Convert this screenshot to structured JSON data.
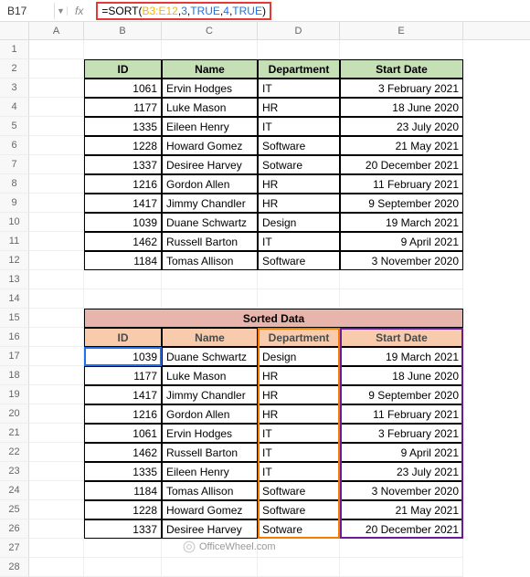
{
  "cellRef": "B17",
  "formula": {
    "eq": "=",
    "fn": "SORT",
    "open": "(",
    "range": "B3:E12",
    "c1": ",",
    "a1": "3",
    "c2": ",",
    "a2": "TRUE",
    "c3": ",",
    "a3": "4",
    "c4": ",",
    "a4": "TRUE",
    "close": ")"
  },
  "cols": [
    "A",
    "B",
    "C",
    "D",
    "E"
  ],
  "table1": {
    "headers": {
      "id": "ID",
      "name": "Name",
      "dept": "Department",
      "date": "Start Date"
    },
    "rows": [
      {
        "id": "1061",
        "name": "Ervin Hodges",
        "dept": "IT",
        "date": "3 February 2021"
      },
      {
        "id": "1177",
        "name": "Luke Mason",
        "dept": "HR",
        "date": "18 June 2020"
      },
      {
        "id": "1335",
        "name": "Eileen Henry",
        "dept": "IT",
        "date": "23 July 2020"
      },
      {
        "id": "1228",
        "name": "Howard Gomez",
        "dept": "Software",
        "date": "21 May 2021"
      },
      {
        "id": "1337",
        "name": "Desiree Harvey",
        "dept": "Sotware",
        "date": "20 December 2021"
      },
      {
        "id": "1216",
        "name": "Gordon Allen",
        "dept": "HR",
        "date": "11 February 2021"
      },
      {
        "id": "1417",
        "name": "Jimmy Chandler",
        "dept": "HR",
        "date": "9 September 2020"
      },
      {
        "id": "1039",
        "name": "Duane Schwartz",
        "dept": "Design",
        "date": "19 March 2021"
      },
      {
        "id": "1462",
        "name": "Russell Barton",
        "dept": "IT",
        "date": "9 April 2021"
      },
      {
        "id": "1184",
        "name": "Tomas Allison",
        "dept": "Software",
        "date": "3 November 2020"
      }
    ]
  },
  "table2": {
    "title": "Sorted Data",
    "headers": {
      "id": "ID",
      "name": "Name",
      "dept": "Department",
      "date": "Start Date"
    },
    "rows": [
      {
        "id": "1039",
        "name": "Duane Schwartz",
        "dept": "Design",
        "date": "19 March 2021"
      },
      {
        "id": "1177",
        "name": "Luke Mason",
        "dept": "HR",
        "date": "18 June 2020"
      },
      {
        "id": "1417",
        "name": "Jimmy Chandler",
        "dept": "HR",
        "date": "9 September 2020"
      },
      {
        "id": "1216",
        "name": "Gordon Allen",
        "dept": "HR",
        "date": "11 February 2021"
      },
      {
        "id": "1061",
        "name": "Ervin Hodges",
        "dept": "IT",
        "date": "3 February 2021"
      },
      {
        "id": "1462",
        "name": "Russell Barton",
        "dept": "IT",
        "date": "9 April 2021"
      },
      {
        "id": "1335",
        "name": "Eileen Henry",
        "dept": "IT",
        "date": "23 July 2021"
      },
      {
        "id": "1184",
        "name": "Tomas Allison",
        "dept": "Software",
        "date": "3 November 2020"
      },
      {
        "id": "1228",
        "name": "Howard Gomez",
        "dept": "Software",
        "date": "21 May 2021"
      },
      {
        "id": "1337",
        "name": "Desiree Harvey",
        "dept": "Sotware",
        "date": "20 December 2021"
      }
    ]
  },
  "watermark": "OfficeWheel.com"
}
